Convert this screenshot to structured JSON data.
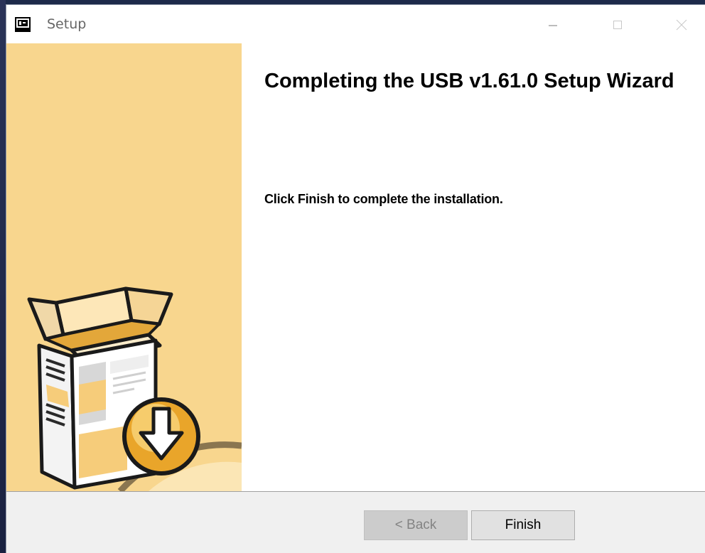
{
  "window": {
    "title": "Setup"
  },
  "titlebar_buttons": {
    "minimize": "minimize-icon",
    "maximize": "maximize-icon",
    "close": "close-icon"
  },
  "wizard": {
    "heading": "Completing the USB v1.61.0 Setup Wizard",
    "body": "Click Finish to complete the installation.",
    "side_image": "installer-box-icon"
  },
  "footer": {
    "back_label": "< Back",
    "back_enabled": false,
    "finish_label": "Finish"
  },
  "colors": {
    "side_panel": "#f8d68e",
    "footer": "#f0f0f0",
    "disabled_button": "#cccccc"
  }
}
